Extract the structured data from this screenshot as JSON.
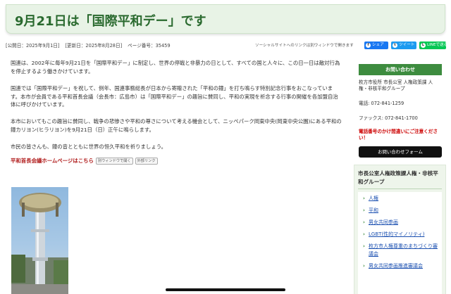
{
  "page": {
    "title": "9月21日は「国際平和デー」です"
  },
  "meta": {
    "published": "[公開日：2025年9月1日]",
    "updated": "[更新日：2025年8月28日]",
    "page_number": "ページ番号：35459",
    "social_note": "ソーシャルサイトへのリンクは別ウィンドウで開きます"
  },
  "share": {
    "facebook": "シェア",
    "twitter": "ツイート",
    "line": "LINEで送る",
    "facebook_icon": "f",
    "twitter_icon": "t",
    "line_icon": "L"
  },
  "main": {
    "p1": "国連は、2002年に毎年9月21日を「国際平和デー」に制定し、世界の停戦と非暴力の日として、すべての国と人々に、この日一日は敵対行為を停止するよう働きかけています。",
    "p2": "国連では「国際平和デー」を祝して、例年、国連事務総長が日本から寄贈された「平和の鐘」を打ち鳴らす特別記念行事をおこなっています。本市が会員である平和首長会議（会長市：広島市）は「国際平和デー」の趣旨に賛同し、平和の実現を祈念する行事の開催を各加盟自治体に呼びかけています。",
    "p3": "本市においてもこの趣旨に賛同し、戦争の悲惨さや平和の尊さについて考える機会として、ニッペパーク岡東中央(岡東中央公園)にある平和の鐘カリヨン(ヒラリヨン)を9月21日（日）正午に鳴らします。",
    "p4": "市民の皆さんも、鐘の音とともに世界の恒久平和を祈りましょう。",
    "link_label": "平和首長会議ホームページはこちら",
    "tag_new_window": "別ウィンドウで開く",
    "tag_external": "外部リンク"
  },
  "contact": {
    "heading": "お問い合わせ",
    "department": "枚方市役所 市長公室 人権政策課 人権・非核平和グループ",
    "tel": "電話: 072-841-1259",
    "fax": "ファックス: 072-841-1700",
    "warning": "電話番号のかけ間違いにご注意ください！",
    "form_button": "お問い合わせフォーム"
  },
  "group": {
    "heading": "市長公室人権政策課人権・非核平和グループ",
    "items": [
      "人権",
      "平和",
      "男女共同参画",
      "LGBT(性的マイノリティ)",
      "枚方市人権尊重のまちづくり審議会",
      "男女共同参画推進審議会"
    ]
  },
  "colors": {
    "accent_green": "#3d8c3f",
    "title_green": "#2a6a2f",
    "link_red": "#b01b1b",
    "link_blue": "#1a4fb0"
  }
}
